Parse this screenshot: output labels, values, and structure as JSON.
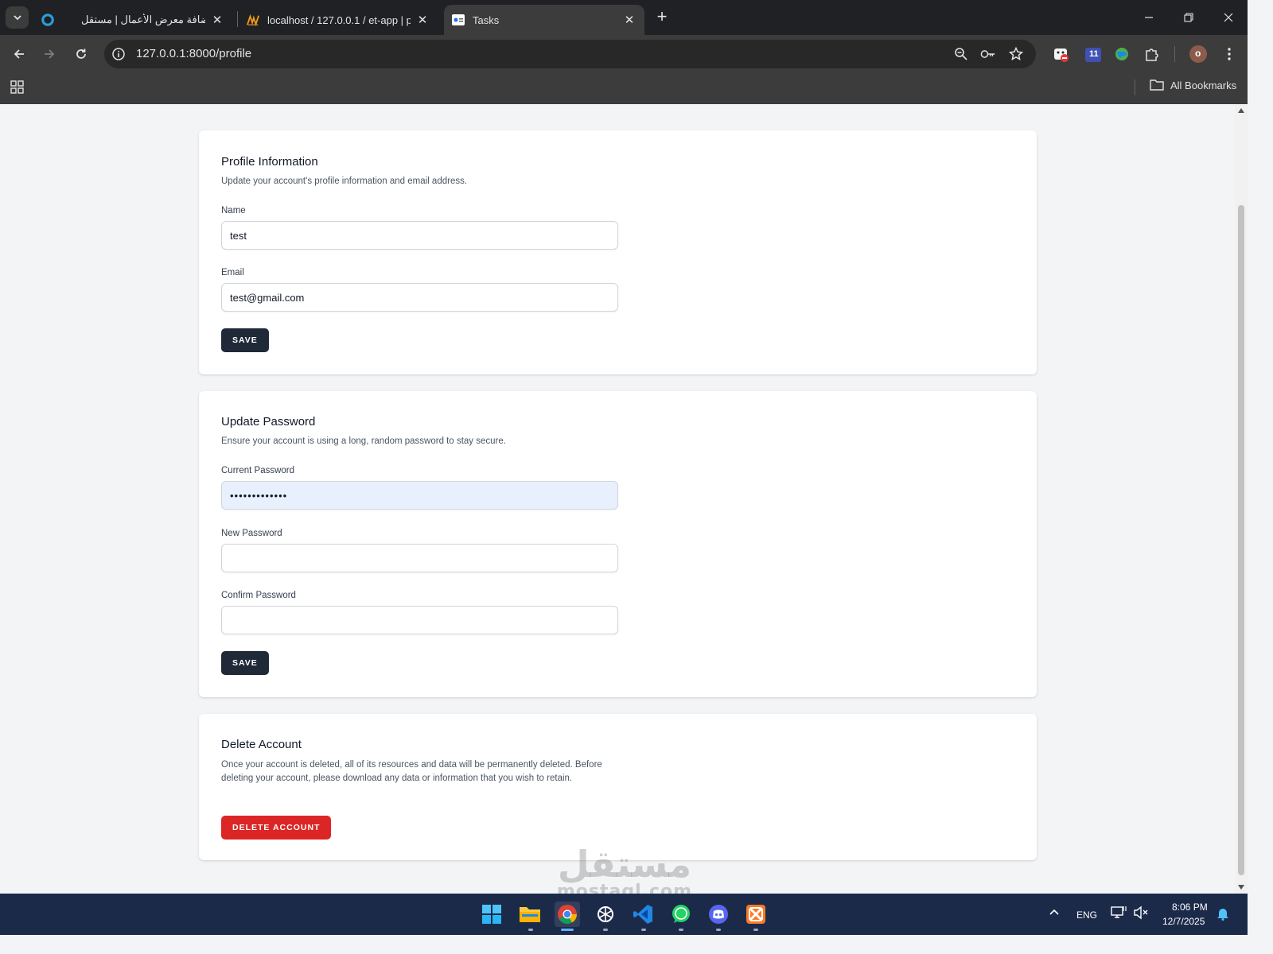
{
  "browser": {
    "tabs": [
      {
        "title": "إضافة معرض الأعمال | مستقل",
        "active": false
      },
      {
        "title": "localhost / 127.0.0.1 / et-app | p",
        "active": false
      },
      {
        "title": "Tasks",
        "active": true
      }
    ],
    "url": "127.0.0.1:8000/profile",
    "all_bookmarks": "All Bookmarks",
    "profile_initial": "o",
    "extension_badge": "11"
  },
  "profile_info": {
    "title": "Profile Information",
    "description": "Update your account's profile information and email address.",
    "name_label": "Name",
    "name_value": "test",
    "email_label": "Email",
    "email_value": "test@gmail.com",
    "save_label": "Save"
  },
  "update_password": {
    "title": "Update Password",
    "description": "Ensure your account is using a long, random password to stay secure.",
    "current_label": "Current Password",
    "current_value": "•••••••••••••",
    "new_label": "New Password",
    "new_value": "",
    "confirm_label": "Confirm Password",
    "confirm_value": "",
    "save_label": "Save"
  },
  "delete_account": {
    "title": "Delete Account",
    "description": "Once your account is deleted, all of its resources and data will be permanently deleted. Before deleting your account, please download any data or information that you wish to retain.",
    "button_label": "Delete Account"
  },
  "watermark": {
    "arabic": "مستقل",
    "latin": "mostaql.com"
  },
  "taskbar": {
    "language": "ENG",
    "time": "8:06 PM",
    "date": "12/7/2025"
  },
  "colors": {
    "chrome_bg": "#202124",
    "toolbar_bg": "#3c3c3c",
    "page_bg": "#f3f4f6",
    "dark_button": "#1f2937",
    "danger_button": "#dc2626",
    "autofill_bg": "#e8f0fe",
    "taskbar_bg": "#1c2a4a"
  }
}
